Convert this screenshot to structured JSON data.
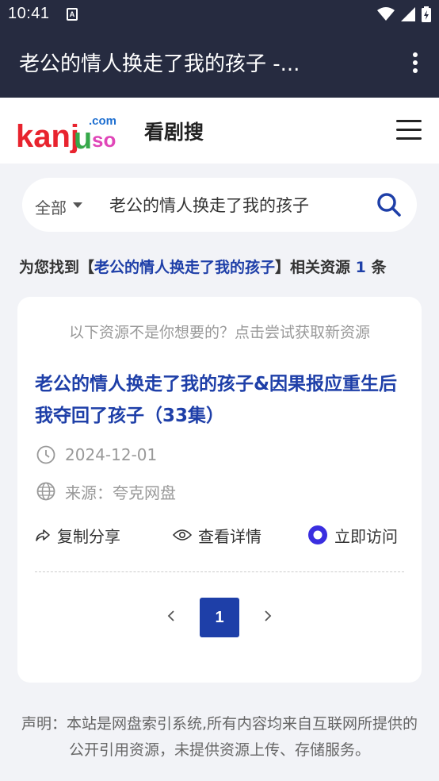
{
  "status_bar": {
    "time": "10:41",
    "notification_icon": "A"
  },
  "app_bar": {
    "title": "老公的情人换走了我的孩子 -..."
  },
  "site": {
    "logo": {
      "main": "kanj",
      "accent": "u",
      "tail": "so",
      "domain": ".com"
    },
    "name": "看剧搜"
  },
  "search": {
    "category": "全部",
    "query": "老公的情人换走了我的孩子"
  },
  "results_summary": {
    "prefix": "为您找到【",
    "keyword": "老公的情人换走了我的孩子",
    "suffix": "】相关资源",
    "count": "1",
    "unit": "条"
  },
  "result": {
    "hint": "以下资源不是你想要的？点击尝试获取新资源",
    "title": "老公的情人换走了我的孩子&因果报应重生后我夺回了孩子（33集）",
    "date": "2024-12-01",
    "source": "来源：夸克网盘",
    "actions": {
      "copy": "复制分享",
      "view": "查看详情",
      "visit": "立即访问"
    }
  },
  "pagination": {
    "current": "1"
  },
  "disclaimer": "声明：本站是网盘索引系统,所有内容均来自互联网所提供的公开引用资源，未提供资源上传、存储服务。",
  "colors": {
    "app_bar": "#262b40",
    "accent": "#1e3fa8",
    "logo_red": "#e8232e",
    "logo_green": "#36a84a",
    "logo_pink": "#e046b8"
  }
}
